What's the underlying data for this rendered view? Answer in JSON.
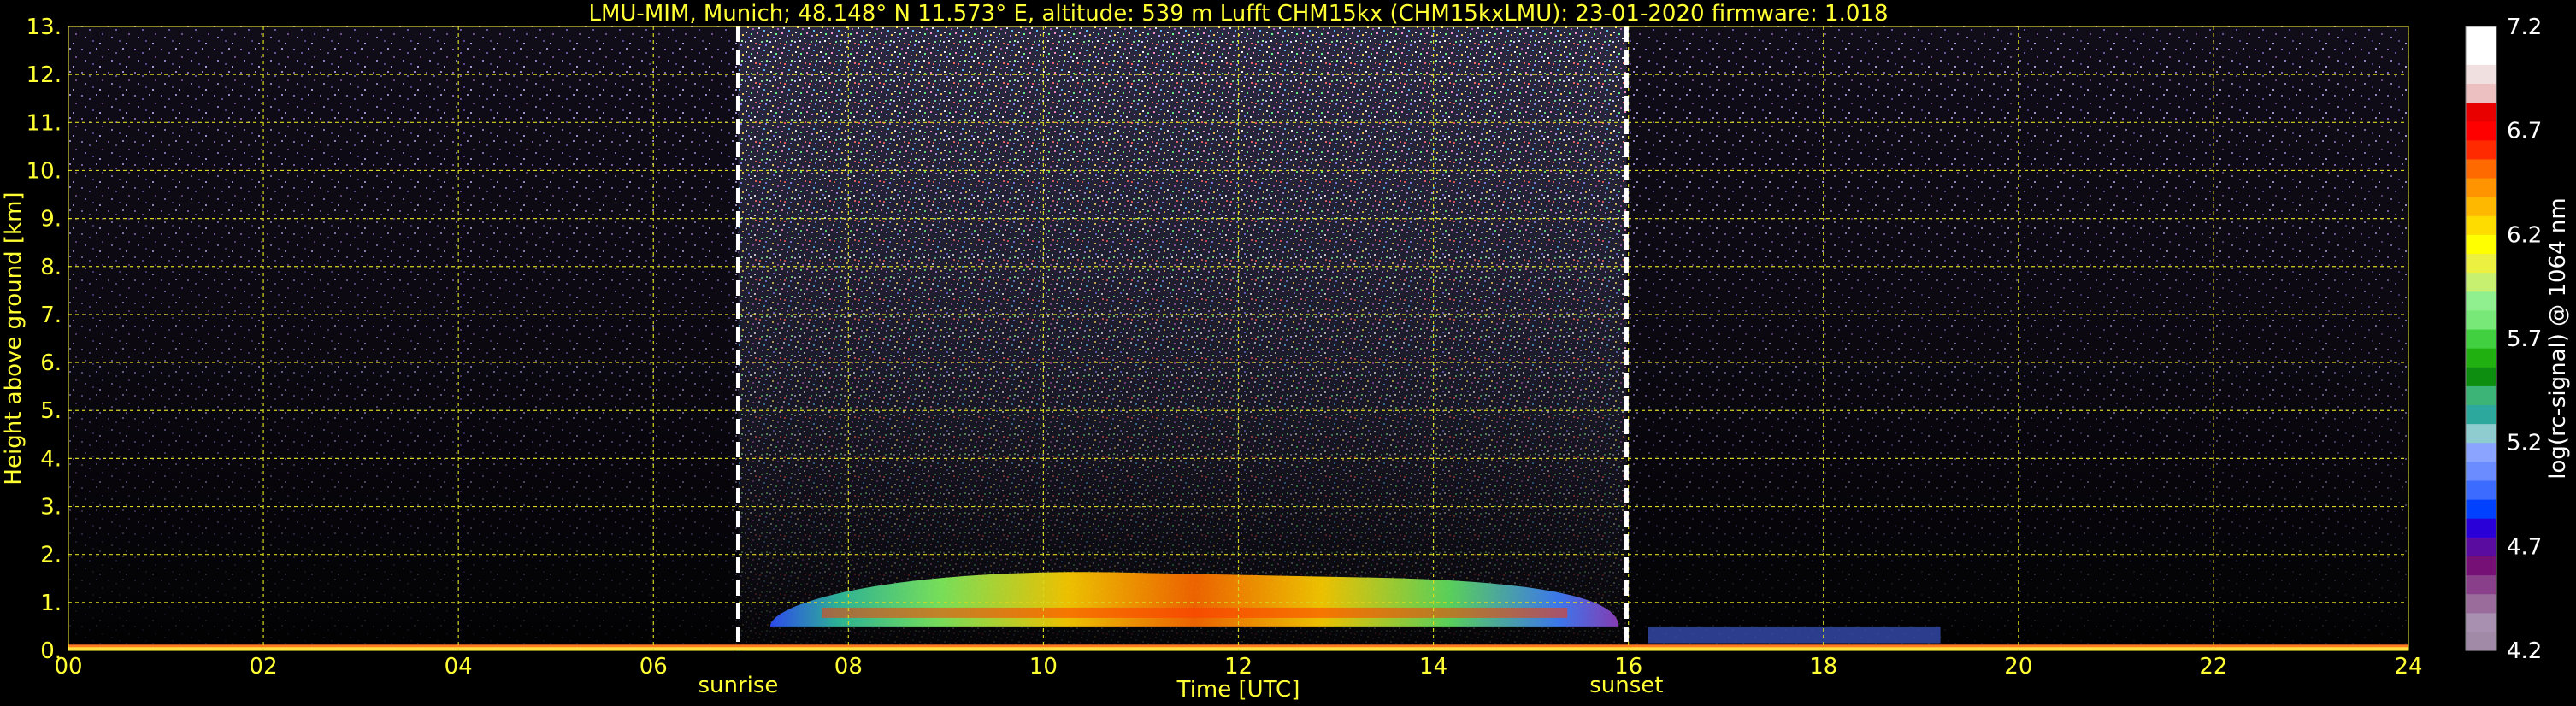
{
  "chart_data": {
    "type": "heatmap",
    "title": "LMU-MIM, Munich; 48.148° N 11.573° E, altitude: 539 m    Lufft CHM15kx (CHM15kxLMU): 23-01-2020    firmware: 1.018",
    "xlabel": "Time [UTC]",
    "ylabel": "Height above ground [km]",
    "xlim": [
      0,
      24
    ],
    "ylim": [
      0,
      13
    ],
    "x_ticks": [
      "00",
      "02",
      "04",
      "06",
      "08",
      "10",
      "12",
      "14",
      "16",
      "18",
      "20",
      "22",
      "24"
    ],
    "y_ticks": [
      "0.",
      "1.",
      "2.",
      "3.",
      "4.",
      "5.",
      "6.",
      "7.",
      "8.",
      "9.",
      "10.",
      "11.",
      "12.",
      "13."
    ],
    "grid": true,
    "markers": [
      {
        "label": "sunrise",
        "x": 6.87
      },
      {
        "label": "sunset",
        "x": 15.98
      }
    ],
    "colorbar": {
      "label": "log(rc-signal) @ 1064 nm",
      "range": [
        4.2,
        7.2
      ],
      "ticks": [
        "7.2",
        "6.7",
        "6.2",
        "5.7",
        "5.2",
        "4.7",
        "4.2"
      ],
      "colors": [
        "#a08aa8",
        "#a890b0",
        "#9a6c9c",
        "#8a3f8a",
        "#760f76",
        "#5a0ca0",
        "#2a00d8",
        "#0040ff",
        "#3c6cff",
        "#6a8cff",
        "#8aa4ff",
        "#8ecccf",
        "#2ca89c",
        "#3cb478",
        "#0e8e10",
        "#20b010",
        "#40d040",
        "#78e878",
        "#90f090",
        "#c8f070",
        "#ecf040",
        "#ffff00",
        "#ffdc00",
        "#ffb800",
        "#ff9400",
        "#ff6a00",
        "#ff2a00",
        "#ff0000",
        "#e80000",
        "#ecc0c0",
        "#f0e0e0",
        "#ffffff",
        "#ffffff"
      ]
    },
    "layers": [
      {
        "type": "surface",
        "x": [
          0,
          24
        ],
        "y": [
          0,
          0.12
        ],
        "value": 6.8
      },
      {
        "type": "boundary-layer",
        "x": [
          7.2,
          15.9
        ],
        "y": [
          0.5,
          1.7
        ],
        "peak_value": 6.6
      },
      {
        "type": "evening-layer",
        "x": [
          16.2,
          19.2
        ],
        "y": [
          0.15,
          0.5
        ],
        "value": 5.0
      }
    ]
  }
}
